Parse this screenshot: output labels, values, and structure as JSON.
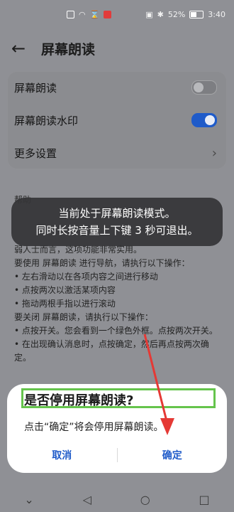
{
  "status_bar": {
    "battery": "52%",
    "time": "3:40"
  },
  "header": {
    "title": "屏幕朗读",
    "back_icon": "arrow-left-icon"
  },
  "settings": [
    {
      "label": "屏幕朗读",
      "type": "switch",
      "on": false
    },
    {
      "label": "屏幕朗读水印",
      "type": "switch",
      "on": true
    },
    {
      "label": "更多设置",
      "type": "chevron"
    }
  ],
  "help": {
    "title": "帮助",
    "lines": [
      "弱人士而言，这项功能非常实用。",
      "要使用 屏幕朗读 进行导航，请执行以下操作：",
      "•  左右滑动以在各项内容之间进行移动",
      "•  点按两次以激活某项内容",
      "•  拖动两根手指以进行滚动",
      "要关闭 屏幕朗读，请执行以下操作：",
      "•  点按开关。您会看到一个绿色外框。点按两次开关。",
      "•  在出现确认消息时，点按确定，然后再点按两次确定。"
    ]
  },
  "toast": {
    "line1": "当前处于屏幕朗读模式。",
    "line2": "同时长按音量上下键 3 秒可退出。"
  },
  "dialog": {
    "title": "是否停用屏幕朗读?",
    "message": "点击“确定”将会停用屏幕朗读。",
    "cancel": "取消",
    "confirm": "确定"
  },
  "colors": {
    "accent": "#1f5bc9",
    "focus_outline": "#65c44c",
    "annotation_arrow": "#e53935"
  }
}
